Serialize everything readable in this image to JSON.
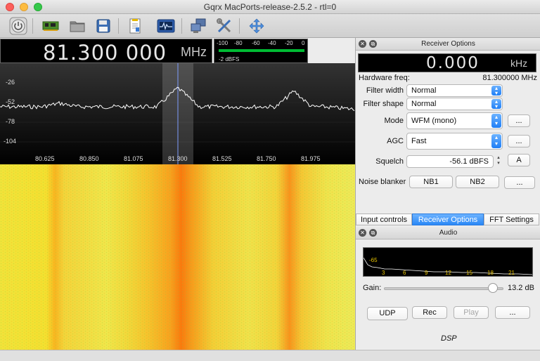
{
  "window": {
    "title": "Gqrx MacPorts-release-2.5.2 - rtl=0"
  },
  "toolbar": {
    "buttons": [
      {
        "name": "power-button",
        "icon": "power-icon"
      },
      {
        "name": "device-config-button",
        "icon": "circuit-board-icon"
      },
      {
        "name": "open-file-button",
        "icon": "folder-icon"
      },
      {
        "name": "save-button",
        "icon": "floppy-disk-icon"
      },
      {
        "name": "notes-button",
        "icon": "document-icon"
      },
      {
        "name": "spectrum-button",
        "icon": "oscilloscope-icon"
      },
      {
        "name": "remote-control-button",
        "icon": "network-computers-icon"
      },
      {
        "name": "settings-button",
        "icon": "tools-icon"
      },
      {
        "name": "fullscreen-button",
        "icon": "move-arrows-icon"
      }
    ]
  },
  "main_freq": {
    "value": "81.300 000",
    "unit": "MHz"
  },
  "signal_meter": {
    "ticks": [
      "-100",
      "-80",
      "-60",
      "-40",
      "-20",
      "0"
    ],
    "level": "-2 dBFS"
  },
  "spectrum": {
    "y_ticks": [
      "-26",
      "-52",
      "-78",
      "-104"
    ],
    "x_ticks": [
      "80.625",
      "80.850",
      "81.075",
      "81.300",
      "81.525",
      "81.750",
      "81.975"
    ]
  },
  "receiver_options": {
    "title": "Receiver Options",
    "offset": {
      "value": "0.000",
      "unit": "kHz"
    },
    "hardware_freq_label": "Hardware freq:",
    "hardware_freq_value": "81.300000 MHz",
    "filter_width_label": "Filter width",
    "filter_width_value": "Normal",
    "filter_shape_label": "Filter shape",
    "filter_shape_value": "Normal",
    "mode_label": "Mode",
    "mode_value": "WFM (mono)",
    "agc_label": "AGC",
    "agc_value": "Fast",
    "squelch_label": "Squelch",
    "squelch_value": "-56.1 dBFS",
    "squelch_auto": "A",
    "noise_blanker_label": "Noise blanker",
    "nb1": "NB1",
    "nb2": "NB2",
    "more": "..."
  },
  "tabs": [
    {
      "label": "Input controls",
      "active": false
    },
    {
      "label": "Receiver Options",
      "active": true
    },
    {
      "label": "FFT Settings",
      "active": false
    }
  ],
  "audio": {
    "title": "Audio",
    "plot_level": "-65",
    "plot_ticks": [
      "3",
      "6",
      "9",
      "12",
      "15",
      "18",
      "21"
    ],
    "gain_label": "Gain:",
    "gain_value": "13.2 dB",
    "gain_level_pct": 91,
    "udp": "UDP",
    "rec": "Rec",
    "play": "Play",
    "more": "...",
    "dsp": "DSP"
  },
  "colors": {
    "accent": "#2a88f6",
    "spectrum_line": "#ffffff",
    "waterfall_hot": "#ff7a00",
    "waterfall_base": "#f3e63a"
  }
}
